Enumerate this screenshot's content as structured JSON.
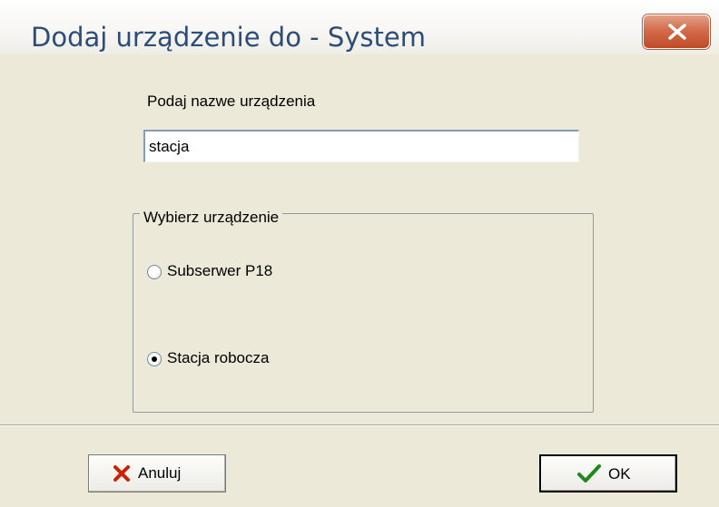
{
  "window": {
    "title": "Dodaj urządzenie do - System",
    "close_icon": "close-icon"
  },
  "form": {
    "name_label": "Podaj nazwe urządzenia",
    "name_value": "stacja",
    "device_group_label": "Wybierz urządzenie",
    "options": [
      {
        "label": "Subserwer P18",
        "selected": false
      },
      {
        "label": "Stacja robocza",
        "selected": true
      }
    ]
  },
  "buttons": {
    "cancel_label": "Anuluj",
    "cancel_icon": "x-icon",
    "ok_label": "OK",
    "ok_icon": "checkmark-icon"
  },
  "colors": {
    "close_button": "#d36c4a",
    "cancel_icon": "#cc2200",
    "ok_icon": "#1e8a1e"
  }
}
